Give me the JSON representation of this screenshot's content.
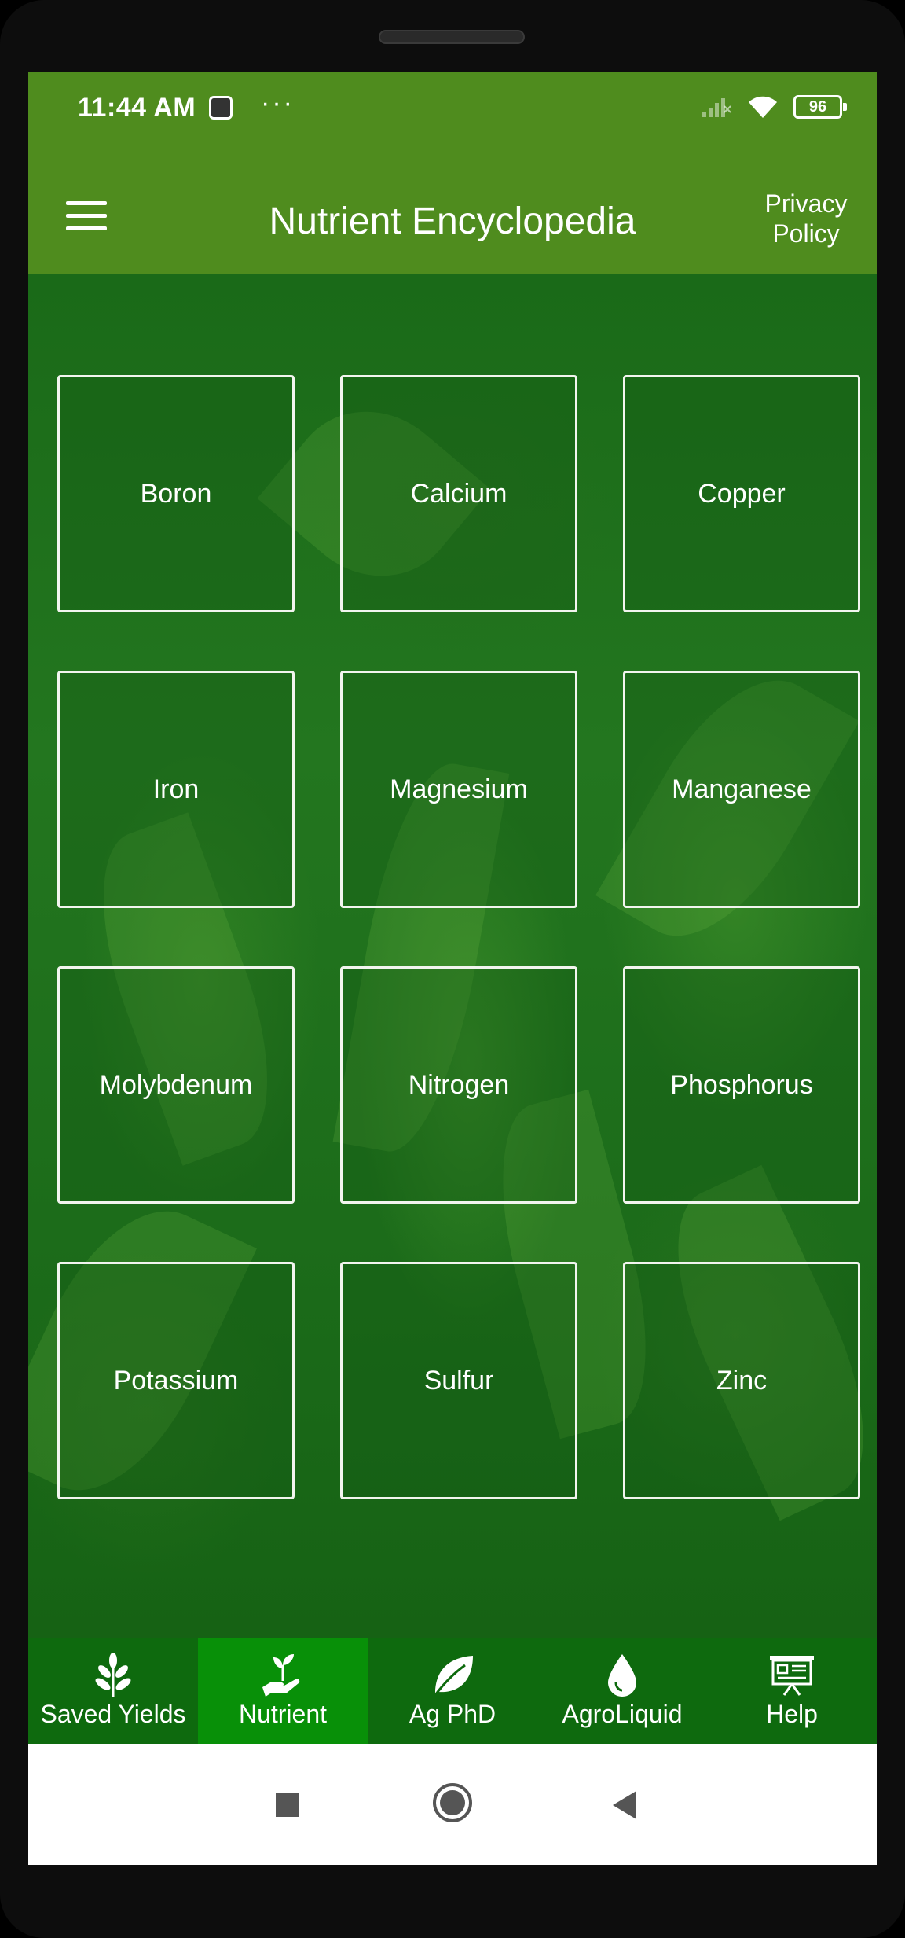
{
  "status_bar": {
    "time": "11:44 AM",
    "dots": "···",
    "battery": "96"
  },
  "app_bar": {
    "title": "Nutrient Encyclopedia",
    "privacy_line1": "Privacy",
    "privacy_line2": "Policy"
  },
  "nutrients": [
    "Boron",
    "Calcium",
    "Copper",
    "Iron",
    "Magnesium",
    "Manganese",
    "Molybdenum",
    "Nitrogen",
    "Phosphorus",
    "Potassium",
    "Sulfur",
    "Zinc"
  ],
  "bottom_nav": {
    "items": [
      {
        "label": "Saved Yields",
        "icon": "sprout-icon"
      },
      {
        "label": "Nutrient",
        "icon": "hand-plant-icon",
        "active": true
      },
      {
        "label": "Ag PhD",
        "icon": "leaf-icon"
      },
      {
        "label": "AgroLiquid",
        "icon": "droplet-icon"
      },
      {
        "label": "Help",
        "icon": "presentation-icon"
      }
    ]
  },
  "colors": {
    "primary": "#4f8c1e",
    "nav_bg": "#0e6a0e",
    "nav_active": "#089008"
  }
}
